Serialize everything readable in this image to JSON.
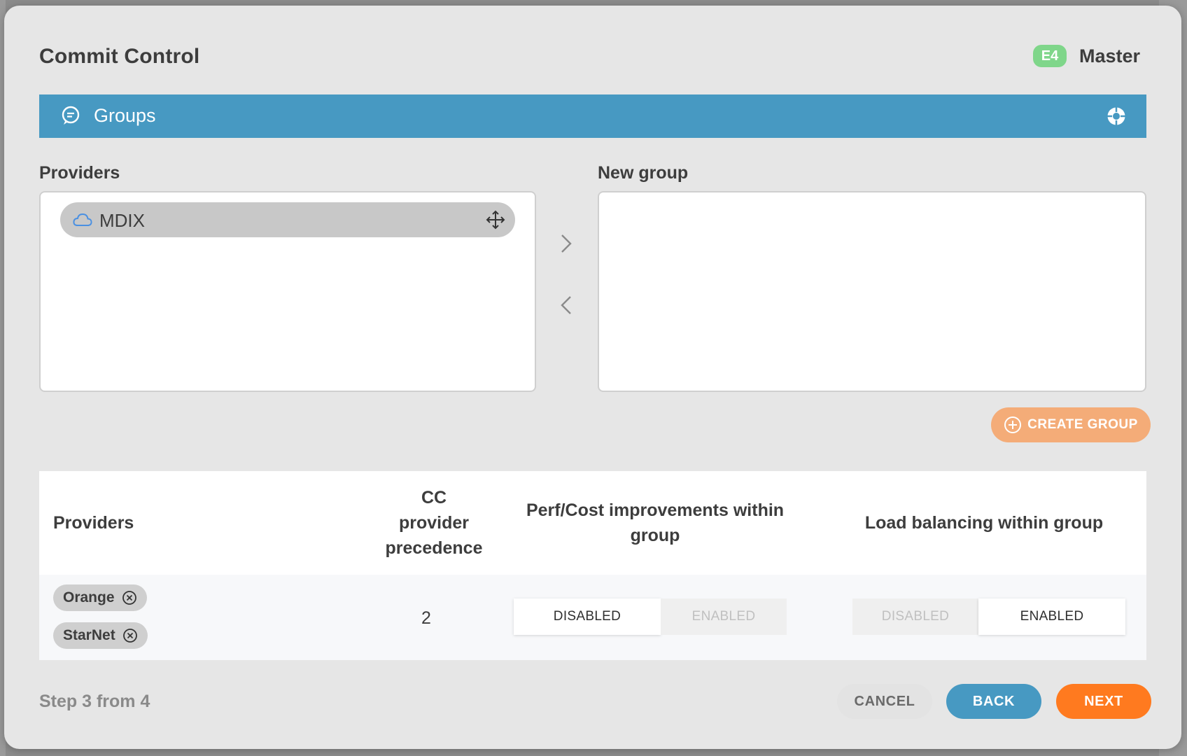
{
  "modal": {
    "title": "Commit Control",
    "env_badge": "E4",
    "env_name": "Master"
  },
  "section": {
    "title": "Groups",
    "icon": "chat-bubble-icon",
    "help_icon": "lifebuoy-icon"
  },
  "providers_panel": {
    "label": "Providers",
    "items": [
      {
        "name": "MDIX",
        "icon": "cloud-icon"
      }
    ]
  },
  "new_group_panel": {
    "label": "New group",
    "items": []
  },
  "create_group_button": "CREATE GROUP",
  "table": {
    "headers": {
      "providers": "Providers",
      "precedence": [
        "CC",
        "provider",
        "precedence"
      ],
      "perf_cost": [
        "Perf/Cost improvements within",
        "group"
      ],
      "load_balancing": "Load balancing within group"
    },
    "rows": [
      {
        "providers": [
          "Orange",
          "StarNet"
        ],
        "precedence": "2",
        "perf_cost": {
          "options": [
            "DISABLED",
            "ENABLED"
          ],
          "selected": "DISABLED"
        },
        "load_balancing": {
          "options": [
            "DISABLED",
            "ENABLED"
          ],
          "selected": "ENABLED"
        }
      }
    ]
  },
  "footer": {
    "step_text": "Step 3 from 4",
    "cancel": "CANCEL",
    "back": "BACK",
    "next": "NEXT"
  },
  "colors": {
    "section_bar": "#4799c2",
    "env_badge": "#7fd68a",
    "create_group": "#f4ac78",
    "next": "#ff7a1f",
    "back": "#4799c2"
  }
}
